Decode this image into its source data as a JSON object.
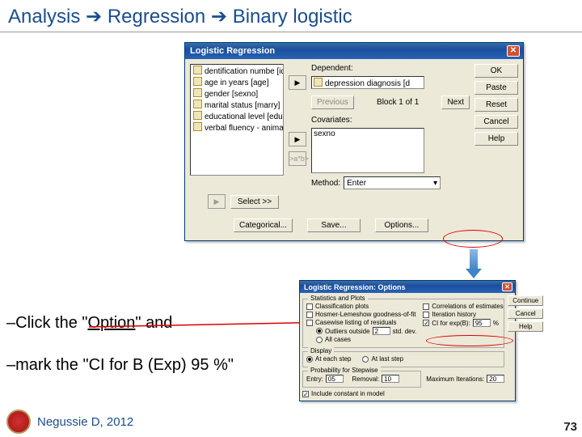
{
  "breadcrumb": {
    "a": "Analysis",
    "b": "Regression",
    "c": "Binary logistic"
  },
  "dialog1": {
    "title": "Logistic Regression",
    "vars": [
      "dentification numbe [id",
      "age in years [age]",
      "gender [sexno]",
      "marital status [marry]",
      "educational level [educ",
      "verbal fluency - animal n"
    ],
    "dependent_label": "Dependent:",
    "dependent_value": "depression diagnosis [d",
    "previous": "Previous",
    "block": "Block 1 of 1",
    "next": "Next",
    "covariates_label": "Covariates:",
    "cov_value": "sexno",
    "axb": ">a*b>",
    "method_label": "Method:",
    "method_value": "Enter",
    "select": "Select >>",
    "categorical": "Categorical...",
    "save": "Save...",
    "options": "Options...",
    "ok": "OK",
    "paste": "Paste",
    "reset": "Reset",
    "cancel": "Cancel",
    "help": "Help"
  },
  "instruction1": {
    "pre": "–Click the \"",
    "link": "Option",
    "post": "\" and"
  },
  "instruction2": "–mark the \"CI for B (Exp) 95 %\"",
  "dialog2": {
    "title": "Logistic Regression: Options",
    "grp_stats": "Statistics and Plots",
    "classification": "Classification plots",
    "hl": "Hosmer-Lemeshow goodness-of-fit",
    "casewise": "Casewise listing of residuals",
    "outliers": "Outliers outside",
    "outliers_val": "2",
    "stddev": "std. dev.",
    "allcases": "All cases",
    "corr": "Correlations of estimates",
    "iter": "Iteration history",
    "ci": "CI for exp(B):",
    "ci_val": "95",
    "ci_pct": "%",
    "grp_display": "Display",
    "eachstep": "At each step",
    "laststep": "At last step",
    "grp_step": "Probability for Stepwise",
    "entry": "Entry:",
    "entry_val": "05",
    "removal": "Removal:",
    "removal_val": "10",
    "maxiter": "Maximum Iterations:",
    "maxiter_val": "20",
    "include": "Include constant in model",
    "continue": "Continue",
    "cancel": "Cancel",
    "help": "Help"
  },
  "footer": {
    "author": "Negussie D, 2012",
    "page": "73"
  }
}
